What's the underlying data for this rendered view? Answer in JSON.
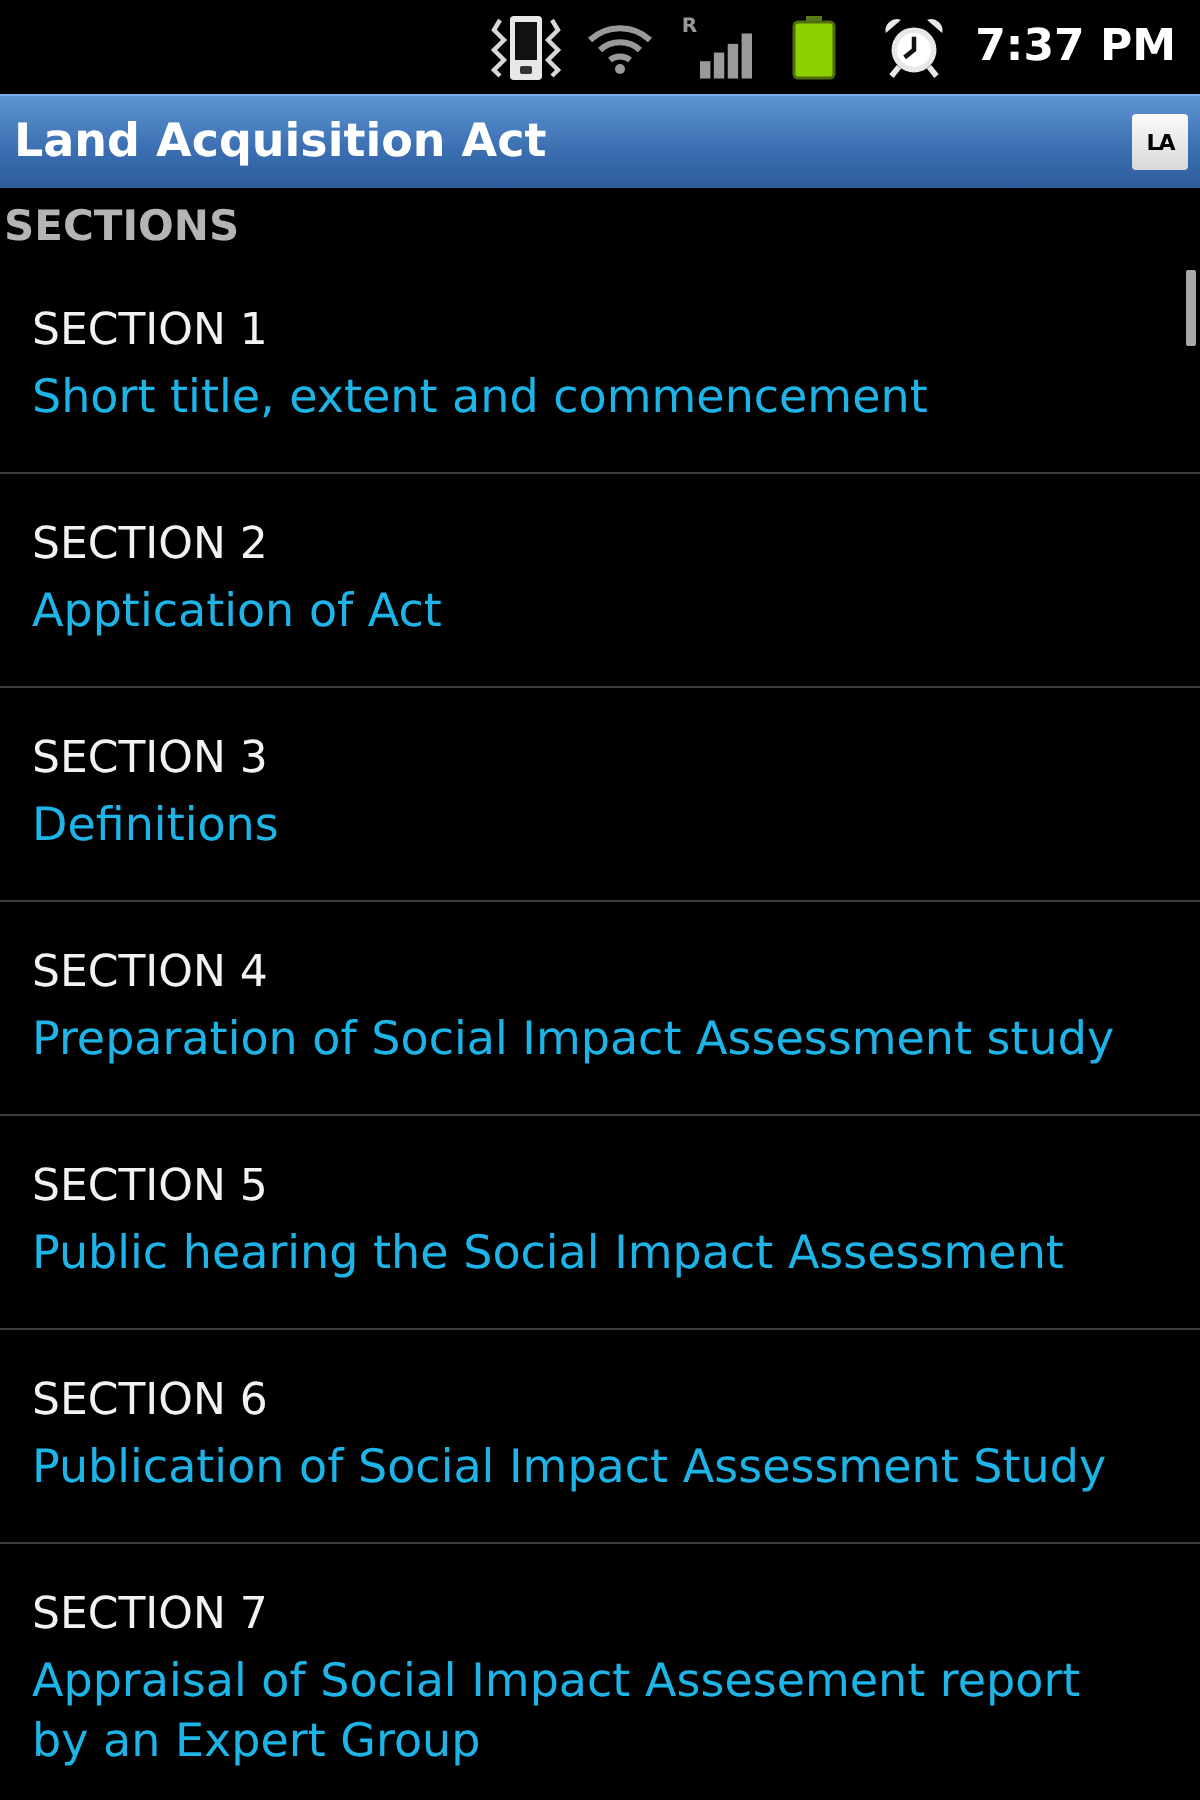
{
  "status_bar": {
    "roaming_indicator": "R",
    "time": "7:37 PM"
  },
  "title_bar": {
    "title": "Land Acquisition Act",
    "app_icon_text": "LA"
  },
  "list_header": "SECTIONS",
  "sections": [
    {
      "label": "SECTION 1",
      "title": "Short title, extent and commencement"
    },
    {
      "label": "SECTION 2",
      "title": "Apptication of Act"
    },
    {
      "label": "SECTION 3",
      "title": "Definitions"
    },
    {
      "label": "SECTION 4",
      "title": "Preparation of Social Impact Assessment study"
    },
    {
      "label": "SECTION 5",
      "title": "Public hearing the Social Impact Assessment"
    },
    {
      "label": "SECTION 6",
      "title": "Publication of Social Impact Assessment Study"
    },
    {
      "label": "SECTION 7",
      "title": "Appraisal of Social Impact Assesement report by an Expert Group"
    }
  ]
}
